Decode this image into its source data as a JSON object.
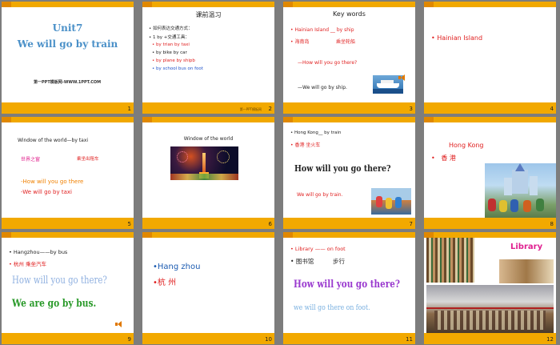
{
  "slides": [
    {
      "num": "1",
      "title": "Unit7",
      "subtitle": "We will go by train",
      "footer": "第一PPT模板网-WWW.1PPT.COM"
    },
    {
      "num": "2",
      "title": "课前温习",
      "lines": [
        "如何表达交通方式：",
        "1 by +交通工具：",
        "by trian  by taxi",
        "by bike     by car",
        "by plane  by shipb",
        "by school bus  on foot"
      ]
    },
    {
      "num": "3",
      "title": "Key words",
      "l1": "Hainian Island __ by ship",
      "l2a": "海南岛",
      "l2b": "乘坐轮船",
      "l3": "—How will you go there?",
      "l4": "—We will go by ship."
    },
    {
      "num": "4",
      "l1": "Hainian Island"
    },
    {
      "num": "5",
      "title": "Window of the world—by taxi",
      "l2a": "世界之窗",
      "l2b": "乘坐出租车",
      "l3": "-How will  you go there",
      "l4": "-We  will go by taxi"
    },
    {
      "num": "6",
      "title": "Window of the world"
    },
    {
      "num": "7",
      "l1": "Hong Kong__ by train",
      "l2": "香港   坐火车",
      "l3": "How will you go there?",
      "l4": "We will go by train."
    },
    {
      "num": "8",
      "l1": "Hong Kong",
      "l2": "香  港"
    },
    {
      "num": "9",
      "l1": "Hangzhou——by bus",
      "l2": "杭州   乘坐汽车",
      "l3": "How will you go there?",
      "l4": "We are go by bus."
    },
    {
      "num": "10",
      "l1": "Hang zhou",
      "l2": "杭 州"
    },
    {
      "num": "11",
      "l1": "Library  —— on foot",
      "l2a": "图书馆",
      "l2b": "步行",
      "l3": "How will you go there?",
      "l4": "we will go there on foot."
    },
    {
      "num": "12",
      "title": "Library"
    }
  ],
  "colors": {
    "accent": "#f2a900",
    "background": "#7d7d7d",
    "red": "#e02020",
    "blue": "#2255cc",
    "title_blue": "#4a90c8"
  }
}
